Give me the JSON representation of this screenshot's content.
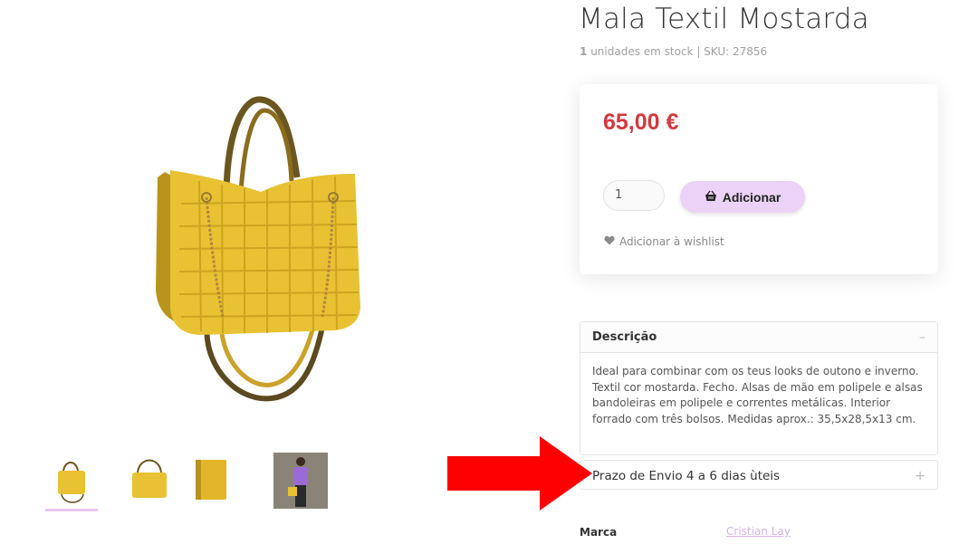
{
  "product": {
    "title": "Mala Textil Mostarda",
    "stock_count": "1",
    "stock_text": "unidades em stock | SKU: 27856",
    "price": "65,00 €",
    "quantity": "1",
    "add_label": "Adicionar",
    "wishlist_label": "Adicionar à wishlist"
  },
  "description": {
    "heading": "Descrição",
    "toggle": "–",
    "body": "Ideal para combinar com os teus looks de outono e inverno. Textil cor mostarda. Fecho. Alsas de mão em polipele e alsas bandoleiras em polipele e correntes metálicas. Interior forrado com três bolsos. Medidas aprox.: 35,5x28,5x13 cm."
  },
  "shipping": {
    "heading": "Prazo de Envio 4 a 6 dias ùteis",
    "toggle": "+"
  },
  "brand": {
    "label": "Marca",
    "value": "Cristian Lay"
  },
  "gallery": {
    "thumbnails": [
      "bag-front",
      "bag-front-alt",
      "bag-side",
      "model-wearing-bag"
    ],
    "active_index": 0
  },
  "colors": {
    "price": "#d1393e",
    "button": "#ecd2f6",
    "bag": "#e8c233",
    "arrow": "#ff0000",
    "brand_link": "#d6b4e6"
  },
  "icons": {
    "add": "basket-icon",
    "wishlist": "heart-icon"
  }
}
